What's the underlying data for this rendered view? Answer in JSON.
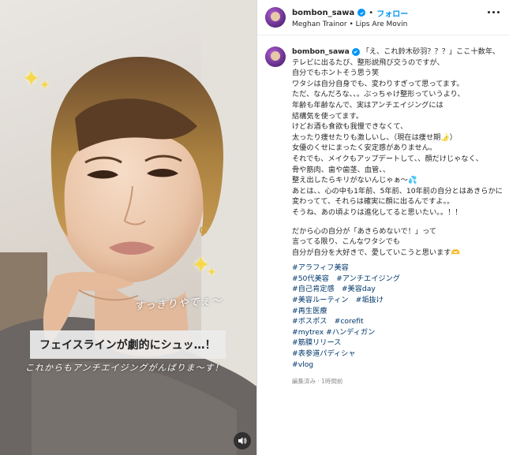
{
  "post": {
    "username": "bombon_sawa",
    "follow_label": "フォロー",
    "separator": "•",
    "audio": "Meghan Trainor • Lips Are Movin"
  },
  "media": {
    "hand_caption": "すっきりやでぇ〜",
    "caption_box": "フェイスラインが劇的にシュッ…！",
    "sub_caption": "これからもアンチエイジングがんばりま〜す！",
    "sparkle_glyph": "✦",
    "mute_icon": "speaker-icon"
  },
  "caption": {
    "first_line": "「え、これ鈴木砂羽？？？」ここ十数年、",
    "lines": [
      "テレビに出るたび、整形説飛び交うのですが、",
      "自分でもホントそう思う笑",
      "ワタシは自分自身でも、変わりすぎって思ってます。",
      "ただ、なんだろな、、。ぶっちゃけ整形っていうより、",
      "年齢も年齢なんで、実はアンチエイジングには",
      "結構気を使ってます。",
      "けどお酒も食欲も我慢できなくて、",
      "太ったり痩せたりも激しいし、（現在は痩せ期🌛）",
      "女優のくせにまったく安定感がありません。",
      "それでも、メイクもアップデートして、、顔だけじゃなく、",
      "骨や筋肉、歯や歯茎、血管、、",
      "整え出したらキリがないんじゃぁ〜💦",
      "あとは、、心の中も1年前、5年前、10年前の自分とはあきらかに",
      "変わってて、それらは確実に顔に出るんですよ。。",
      "そうね、あの頃よりは進化してると思いたい。。！！"
    ],
    "lines_2": [
      "だから心の自分が「あきらめないで！」って",
      "言ってる限り、こんなワタシでも",
      "自分が自分を大好きで、愛していこうと思います🫶"
    ],
    "hashtags": [
      "#アラフィフ美容",
      "#50代美容　#アンチエイジング",
      "#自己肯定感　#美容day",
      "#美容ルーティン　#垢抜け",
      "#再生医療",
      "#ボスポス　#corefit",
      "#mytrex #ハンディガン",
      "#筋膜リリース",
      "#表参道パディシャ",
      "#vlog"
    ],
    "meta": "編集済み · 1時間前"
  },
  "colors": {
    "accent": "#0095f6",
    "hashtag": "#00376b",
    "muted": "#8e8e8e"
  }
}
